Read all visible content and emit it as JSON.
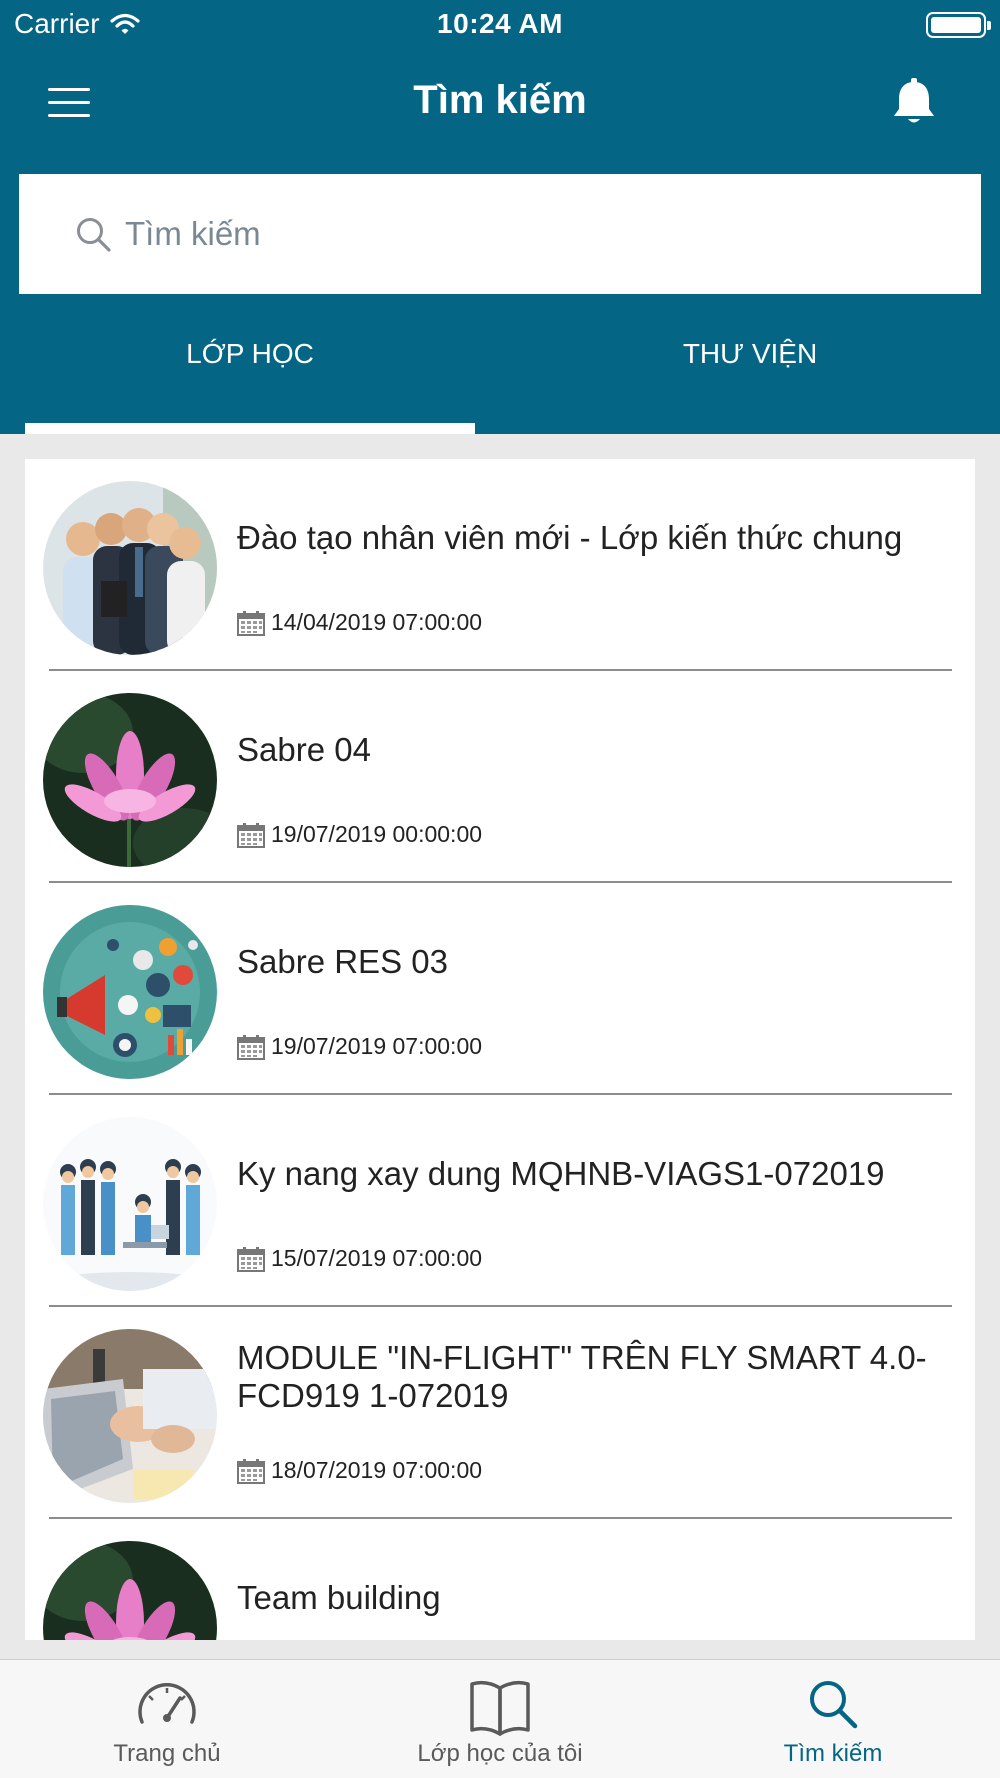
{
  "status_bar": {
    "carrier": "Carrier",
    "time": "10:24 AM"
  },
  "nav": {
    "title": "Tìm kiếm"
  },
  "search": {
    "placeholder": "Tìm kiếm"
  },
  "tabs": {
    "classes": "LỚP HỌC",
    "library": "THƯ VIỆN",
    "active": "classes"
  },
  "courses": [
    {
      "title": "Đào tạo nhân viên mới - Lớp kiến thức chung",
      "date": "14/04/2019 07:00:00",
      "image": "business-team"
    },
    {
      "title": "Sabre 04",
      "date": "19/07/2019 00:00:00",
      "image": "lotus-flower"
    },
    {
      "title": "Sabre RES 03",
      "date": "19/07/2019 07:00:00",
      "image": "marketing-megaphone"
    },
    {
      "title": "Ky nang xay dung MQHNB-VIAGS1-072019",
      "date": "15/07/2019 07:00:00",
      "image": "cartoon-office-team"
    },
    {
      "title": "MODULE \"IN-FLIGHT\" TRÊN FLY SMART 4.0-FCD919 1-072019",
      "date": "18/07/2019 07:00:00",
      "image": "laptop-typing"
    },
    {
      "title": "Team building",
      "date": "",
      "image": "lotus-flower"
    }
  ],
  "tab_bar": {
    "home": "Trang chủ",
    "my_classes": "Lớp học của tôi",
    "search": "Tìm kiếm",
    "active": "search"
  },
  "colors": {
    "brand": "#046585",
    "text": "#222222",
    "inactive": "#5a5a5a"
  }
}
